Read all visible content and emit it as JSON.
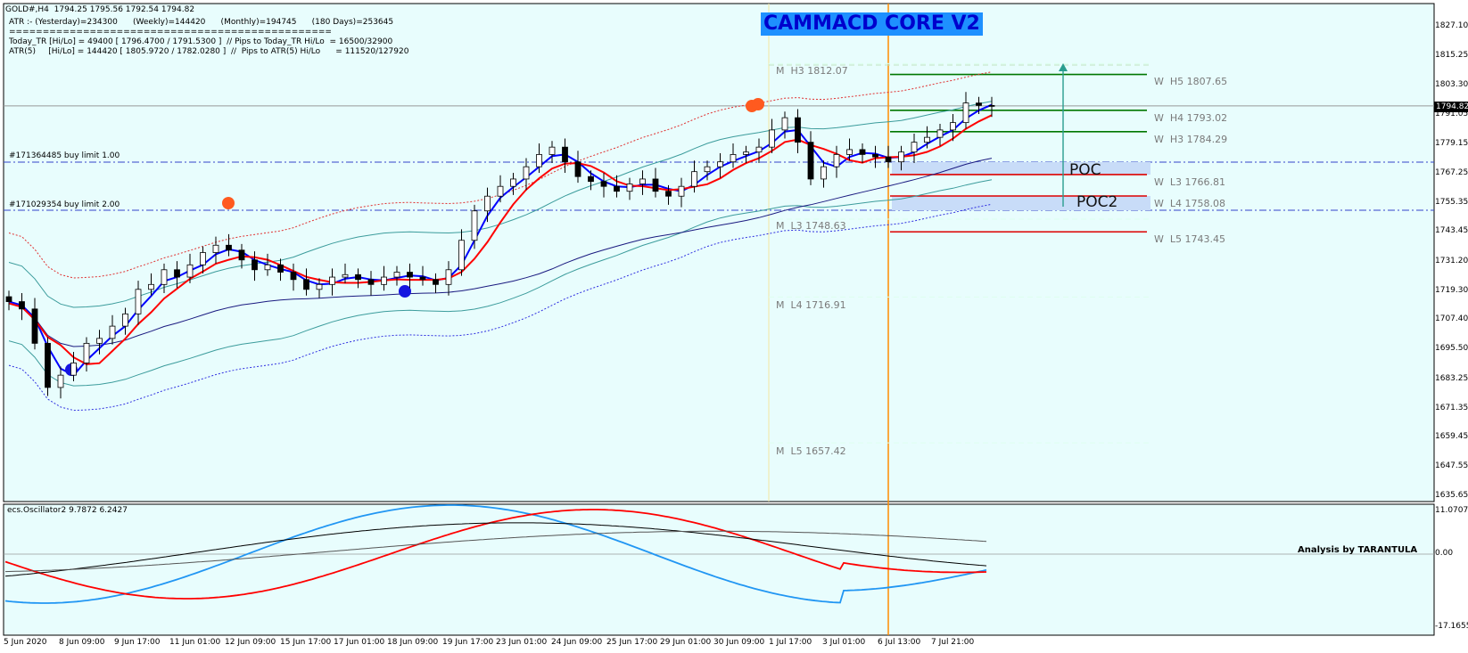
{
  "header": {
    "symbol_line": "GOLD#,H4  1794.25 1795.56 1792.54 1794.82",
    "atr_line": "ATR :- (Yesterday)=234300      (Weekly)=144420      (Monthly)=194745      (180 Days)=253645",
    "sep_line": "================================================",
    "today_line": "Today_TR [Hi/Lo] = 49400 [ 1796.4700 / 1791.5300 ]  // Pips to Today_TR Hi/Lo  = 16500/32900",
    "atr5_line": "ATR(5)     [Hi/Lo] = 144420 [ 1805.9720 / 1782.0280 ]  //  Pips to ATR(5) Hi/Lo      = 111520/127920"
  },
  "title": "CAMMACD CORE V2",
  "orders": [
    "#171364485 buy limit 1.00",
    "#171029354 buy limit 2.00"
  ],
  "pivots_monthly": [
    {
      "label": "M  H3 1812.07",
      "value": 1812.07
    },
    {
      "label": "M  L3 1748.63",
      "value": 1748.63
    },
    {
      "label": "M  L4 1716.91",
      "value": 1716.91
    },
    {
      "label": "M  L5 1657.42",
      "value": 1657.42
    }
  ],
  "pivots_weekly": [
    {
      "label": "W  H5 1807.65",
      "value": 1807.65
    },
    {
      "label": "W  H4 1793.02",
      "value": 1793.02
    },
    {
      "label": "W  H3 1784.29",
      "value": 1784.29
    },
    {
      "label": "W  L3 1766.81",
      "value": 1766.81
    },
    {
      "label": "W  L4 1758.08",
      "value": 1758.08
    },
    {
      "label": "W  L5 1743.45",
      "value": 1743.45
    }
  ],
  "poc_labels": [
    "POC",
    "POC2"
  ],
  "current_price": "1794.82",
  "price_axis": [
    "1827.10",
    "1815.25",
    "1803.30",
    "1791.05",
    "1779.15",
    "1767.25",
    "1755.35",
    "1743.45",
    "1731.20",
    "1719.30",
    "1707.40",
    "1695.50",
    "1683.25",
    "1671.35",
    "1659.45",
    "1647.55",
    "1635.65"
  ],
  "osc_title": "ecs.Oscillator2 9.7872 6.2427",
  "osc_axis": [
    "11.0707",
    "0.00",
    "-17.1655"
  ],
  "analysis_credit": "Analysis by TARANTULA",
  "time_axis": [
    "5 Jun 2020",
    "8 Jun 09:00",
    "9 Jun 17:00",
    "11 Jun 01:00",
    "12 Jun 09:00",
    "15 Jun 17:00",
    "17 Jun 01:00",
    "18 Jun 09:00",
    "19 Jun 17:00",
    "23 Jun 01:00",
    "24 Jun 09:00",
    "25 Jun 17:00",
    "29 Jun 01:00",
    "30 Jun 09:00",
    "1 Jul 17:00",
    "3 Jul 01:00",
    "6 Jul 13:00",
    "7 Jul 21:00"
  ],
  "colors": {
    "background": "#e8fdfd",
    "price_line": "#000000",
    "ma_blue": "#0000ff",
    "ma_red": "#ff0000",
    "bands": "#3c9c9c",
    "order_line": "#3344cc",
    "title_bg": "#1e90ff",
    "title_fg": "#0000cd",
    "poc_fill": "#c8dcf8",
    "osc_blue": "#2196f3",
    "osc_red": "#ff0000",
    "osc_black": "#000000",
    "pivot_green": "#007700",
    "pivot_red": "#dd0000",
    "vline_orange": "#ff8c00"
  },
  "chart_data": {
    "type": "candlestick",
    "symbol": "GOLD#",
    "timeframe": "H4",
    "ohlc_last": {
      "open": 1794.25,
      "high": 1795.56,
      "low": 1792.54,
      "close": 1794.82
    },
    "ylim": [
      1635.65,
      1832
    ],
    "x_labels": [
      "5 Jun 2020",
      "8 Jun 09:00",
      "9 Jun 17:00",
      "11 Jun 01:00",
      "12 Jun 09:00",
      "15 Jun 17:00",
      "17 Jun 01:00",
      "18 Jun 09:00",
      "19 Jun 17:00",
      "23 Jun 01:00",
      "24 Jun 09:00",
      "25 Jun 17:00",
      "29 Jun 01:00",
      "30 Jun 09:00",
      "1 Jul 17:00",
      "3 Jul 01:00",
      "6 Jul 13:00",
      "7 Jul 21:00"
    ],
    "close_approx": [
      1715,
      1712,
      1698,
      1680,
      1685,
      1690,
      1698,
      1700,
      1705,
      1710,
      1720,
      1722,
      1728,
      1725,
      1730,
      1735,
      1738,
      1736,
      1732,
      1728,
      1730,
      1727,
      1724,
      1720,
      1722,
      1725,
      1726,
      1724,
      1722,
      1725,
      1727,
      1725,
      1724,
      1722,
      1728,
      1740,
      1752,
      1758,
      1762,
      1765,
      1770,
      1775,
      1778,
      1772,
      1766,
      1764,
      1762,
      1760,
      1763,
      1765,
      1760,
      1758,
      1762,
      1768,
      1770,
      1772,
      1775,
      1776,
      1778,
      1785,
      1790,
      1780,
      1765,
      1770,
      1775,
      1777,
      1775,
      1774,
      1772,
      1776,
      1780,
      1782,
      1785,
      1788,
      1796,
      1795,
      1794.82
    ],
    "oscillator": {
      "title": "ecs.Oscillator2",
      "values": [
        9.7872,
        6.2427
      ],
      "ylim": [
        -17.1655,
        11.0707
      ]
    }
  }
}
